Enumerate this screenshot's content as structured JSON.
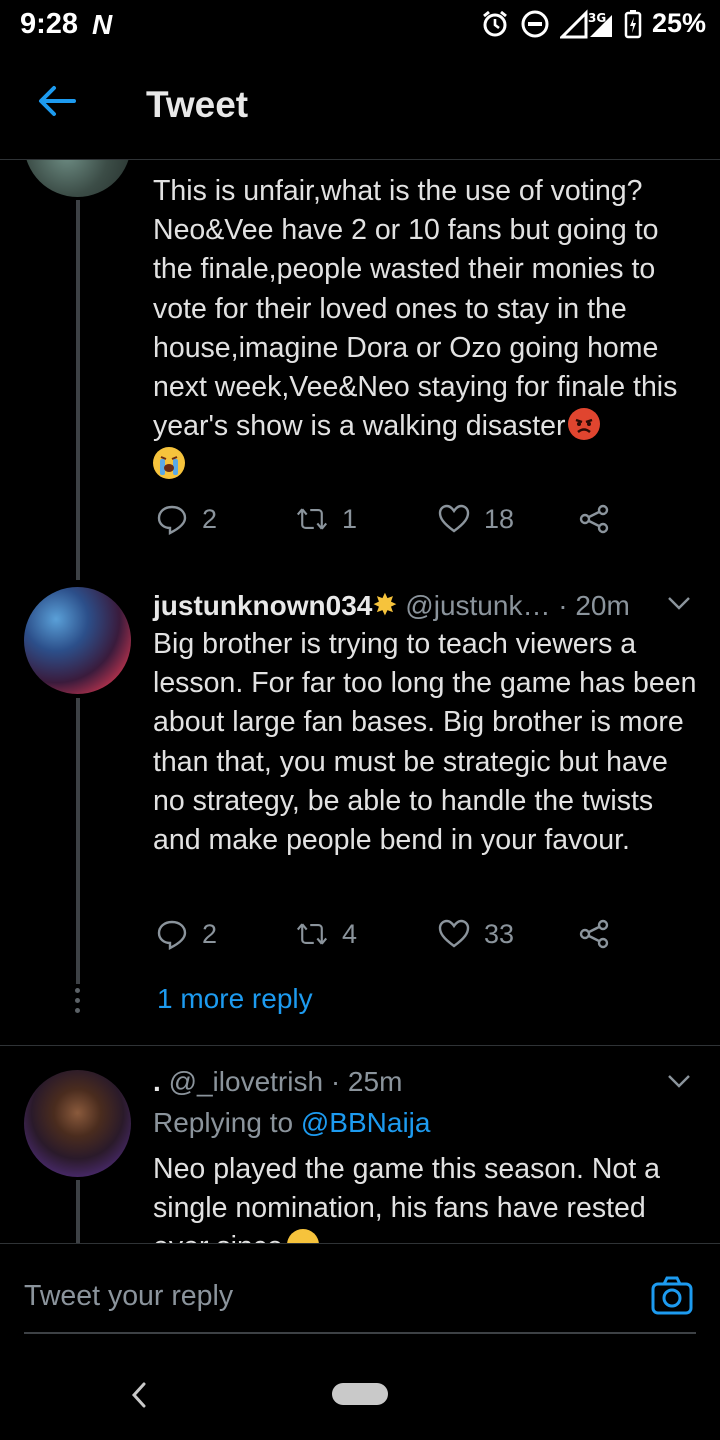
{
  "status_bar": {
    "time": "9:28",
    "network": "3G",
    "battery": "25%"
  },
  "header": {
    "title": "Tweet"
  },
  "tweets": [
    {
      "text_line1": "This is unfair,what is the use of voting? Neo&Vee have 2 or 10 fans but going to the finale,people wasted their monies to vote for their loved ones to stay in the house,imagine Dora or Ozo going home next week,Vee&Neo staying for finale this year's show is a walking disaster",
      "replies": "2",
      "retweets": "1",
      "likes": "18"
    },
    {
      "display_name": "justunknown034",
      "handle": "@justunk…",
      "time": "· 20m",
      "text": "Big brother is trying to teach viewers a lesson. For far too long the game has been about large fan bases. Big brother is more than that, you must be strategic but have no strategy, be able to handle the twists and make people bend in your favour.",
      "replies": "2",
      "retweets": "4",
      "likes": "33",
      "more_replies": "1 more reply"
    },
    {
      "display_name": ".",
      "handle": "@_ilovetrish",
      "time": "· 25m",
      "replying_prefix": "Replying to",
      "replying_to": "@BBNaija",
      "text": "Neo played the game this season. Not a single nomination, his fans have rested ever since"
    }
  ],
  "composer": {
    "placeholder": "Tweet your reply"
  },
  "colors": {
    "accent": "#1d9bf0",
    "muted": "#8b949c",
    "background": "#000000"
  }
}
